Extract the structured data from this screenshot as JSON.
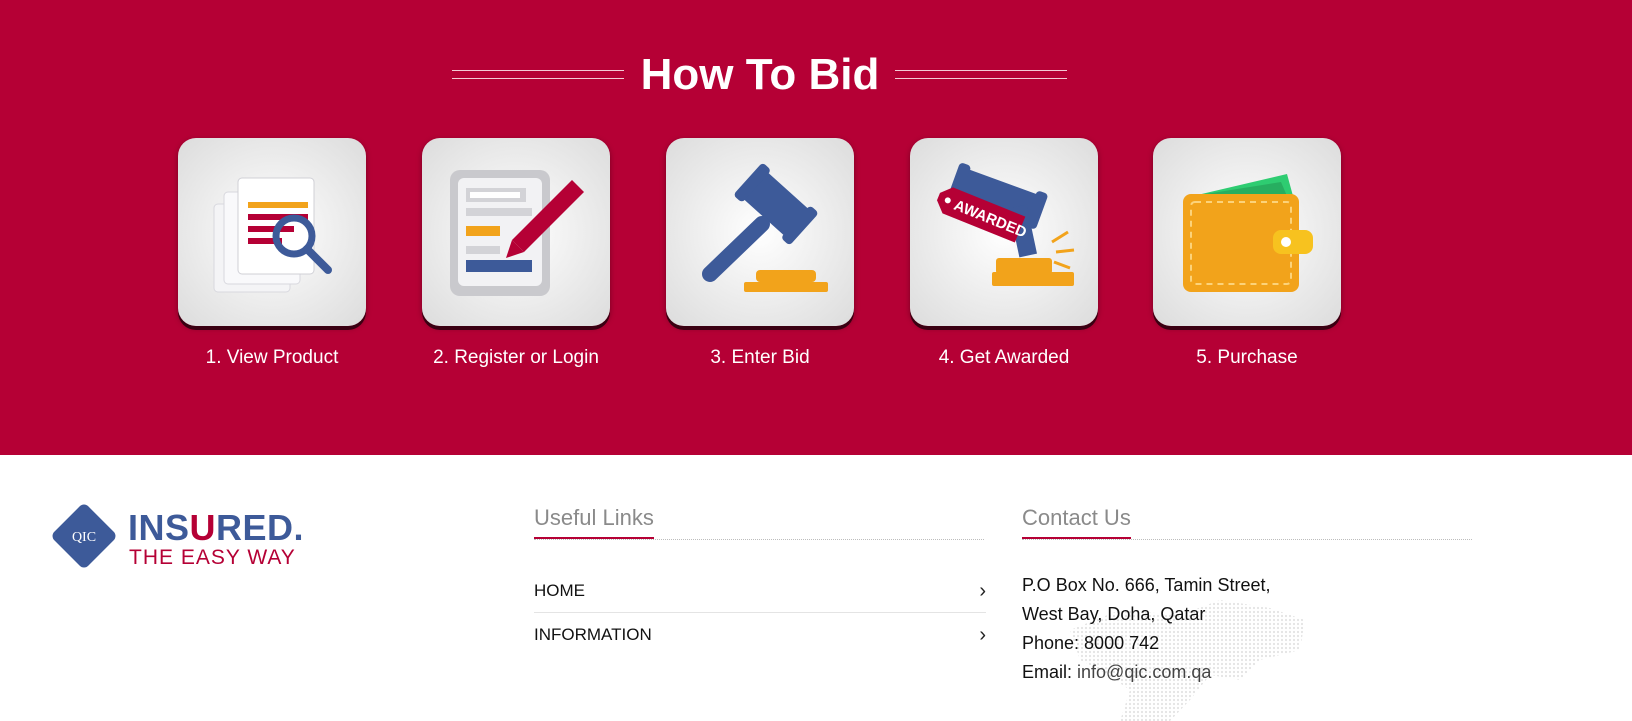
{
  "how_to_bid": {
    "title": "How To Bid",
    "steps": [
      {
        "label": "1. View Product",
        "icon": "document-search-icon"
      },
      {
        "label": "2. Register or Login",
        "icon": "form-pencil-icon"
      },
      {
        "label": "3. Enter Bid",
        "icon": "gavel-icon"
      },
      {
        "label": "4. Get Awarded",
        "icon": "awarded-gavel-icon",
        "tag_text": "AWARDED"
      },
      {
        "label": "5. Purchase",
        "icon": "wallet-icon"
      }
    ]
  },
  "footer": {
    "logo": {
      "badge": "QIC",
      "word_pre": "INS",
      "word_u": "U",
      "word_post": "RED.",
      "tagline": "THE EASY WAY"
    },
    "useful_links": {
      "heading": "Useful Links",
      "items": [
        {
          "label": "HOME"
        },
        {
          "label": "INFORMATION"
        }
      ]
    },
    "contact": {
      "heading": "Contact Us",
      "address_line1": "P.O Box No. 666, Tamin Street,",
      "address_line2": "West Bay, Doha, Qatar",
      "phone": "Phone: 8000 742",
      "email_label": "Email:",
      "email": "info@qic.com.qa"
    }
  },
  "colors": {
    "brand_red": "#b50035",
    "brand_blue": "#3d5a99",
    "accent_orange": "#f2a31b"
  }
}
